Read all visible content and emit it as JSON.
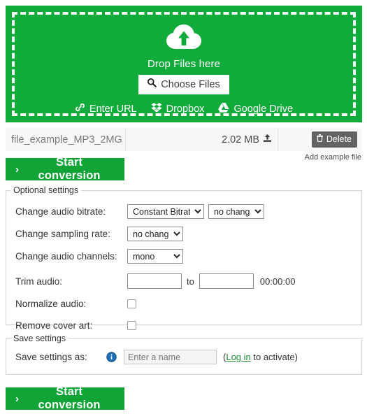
{
  "theme": {
    "green": "#11ab3b",
    "button_green": "#10a437",
    "delete_gray": "#636363",
    "link_green": "#1f8b33"
  },
  "dropzone": {
    "icon": "cloud-upload-icon",
    "title": "Drop Files here",
    "choose_button": {
      "label": "Choose Files",
      "icon": "search-icon"
    },
    "services": [
      {
        "label": "Enter URL",
        "icon": "link-icon"
      },
      {
        "label": "Dropbox",
        "icon": "dropbox-icon"
      },
      {
        "label": "Google Drive",
        "icon": "google-drive-icon"
      }
    ]
  },
  "file_row": {
    "name": "file_example_MP3_2MG",
    "size": "2.02 MB",
    "size_icon": "upload-icon",
    "delete_label": "Delete",
    "delete_icon": "trash-icon"
  },
  "add_example_file": "Add example file",
  "start_conversion": {
    "label": "Start conversion",
    "chevron": "›"
  },
  "optional_settings": {
    "legend": "Optional settings",
    "rows": {
      "bitrate": {
        "label": "Change audio bitrate:",
        "mode_value": "Constant Bitrate",
        "quality_value": "no change"
      },
      "sampling": {
        "label": "Change sampling rate:",
        "value": "no change"
      },
      "channels": {
        "label": "Change audio channels:",
        "value": "mono"
      },
      "trim": {
        "label": "Trim audio:",
        "from_value": "",
        "to_word": "to",
        "to_value": "",
        "duration": "00:00:00"
      },
      "normalize": {
        "label": "Normalize audio:",
        "checked": false
      },
      "cover_art": {
        "label": "Remove cover art:",
        "checked": false
      }
    }
  },
  "save_settings": {
    "legend": "Save settings",
    "label": "Save settings as:",
    "info_icon": "info-icon",
    "input_placeholder": "Enter a name",
    "input_value": "",
    "activate_prefix": "(",
    "activate_link": "Log in",
    "activate_suffix": " to activate)"
  }
}
